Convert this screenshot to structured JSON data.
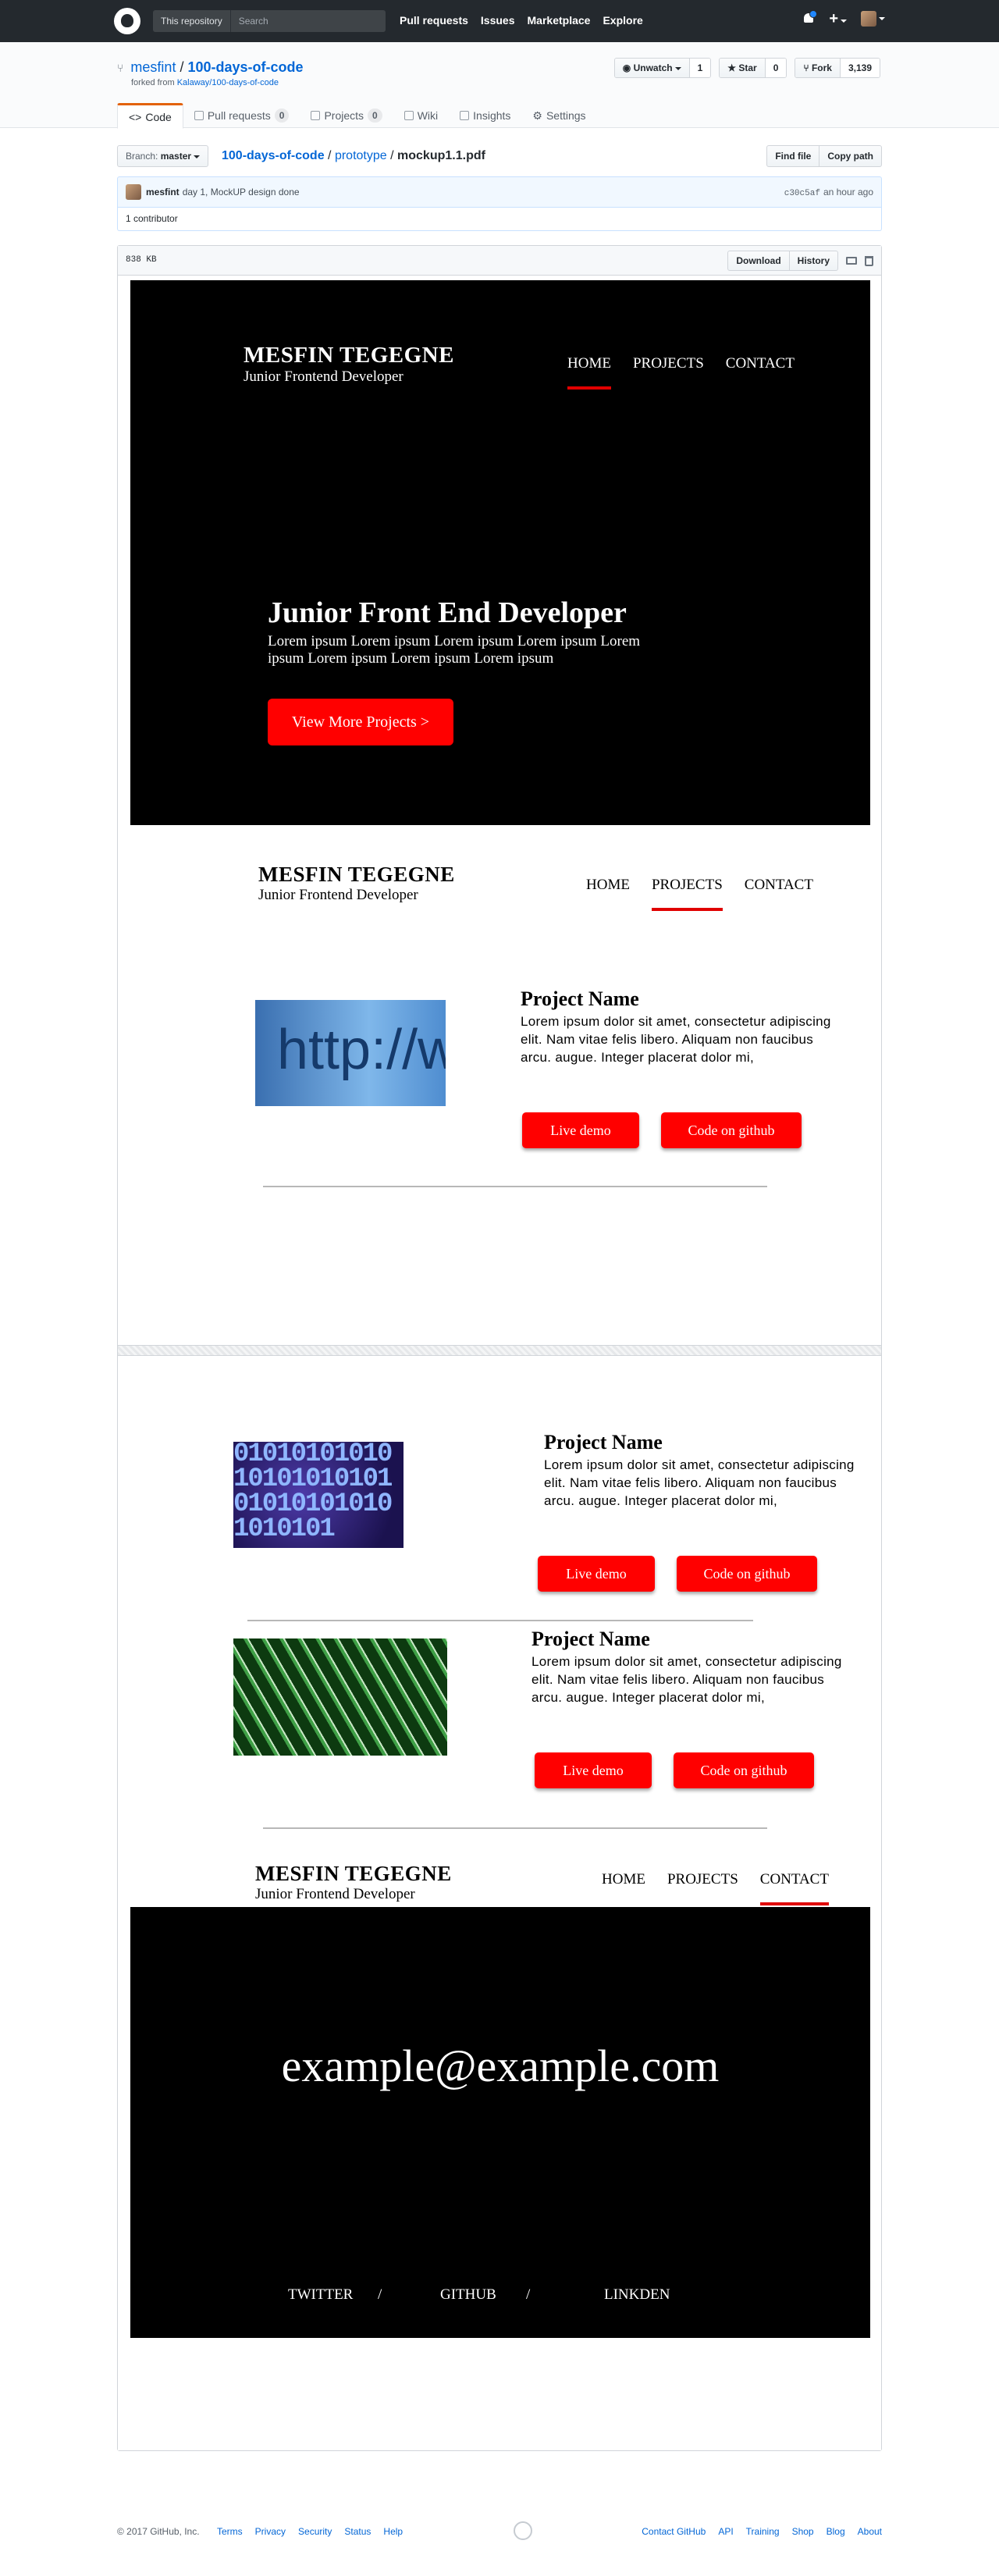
{
  "header": {
    "search_scope": "This repository",
    "search_placeholder": "Search",
    "nav": [
      "Pull requests",
      "Issues",
      "Marketplace",
      "Explore"
    ]
  },
  "repo": {
    "owner": "mesfint",
    "separator": "/",
    "name": "100-days-of-code",
    "forked_prefix": "forked from",
    "forked_from": "Kalaway/100-days-of-code",
    "watch_label": "Unwatch",
    "watch_count": "1",
    "star_label": "Star",
    "star_count": "0",
    "fork_label": "Fork",
    "fork_count": "3,139",
    "tabs": [
      {
        "label": "Code"
      },
      {
        "label": "Pull requests",
        "count": "0"
      },
      {
        "label": "Projects",
        "count": "0"
      },
      {
        "label": "Wiki"
      },
      {
        "label": "Insights"
      },
      {
        "label": "Settings"
      }
    ]
  },
  "file_nav": {
    "branch_prefix": "Branch:",
    "branch": "master",
    "crumb_repo": "100-days-of-code",
    "crumb_dir": "prototype",
    "crumb_file": "mockup1.1.pdf",
    "find_file": "Find file",
    "copy_path": "Copy path"
  },
  "commit": {
    "author": "mesfint",
    "message": "day 1, MockUP design done",
    "sha": "c30c5af",
    "time": "an hour ago",
    "contributors": "1 contributor"
  },
  "file": {
    "size": "838 KB",
    "download": "Download",
    "history": "History"
  },
  "mockup": {
    "brand_name": "MESFIN TEGEGNE",
    "brand_role": "Junior Frontend Developer",
    "nav": [
      "HOME",
      "PROJECTS",
      "CONTACT"
    ],
    "hero_title": "Junior Front End Developer",
    "hero_text": "Lorem ipsum Lorem ipsum Lorem ipsum Lorem ipsum Lorem ipsum Lorem ipsum Lorem ipsum Lorem ipsum",
    "hero_button": "View More Projects  >",
    "project_title": "Project Name",
    "project_desc": "Lorem ipsum dolor sit amet, consectetur adipiscing elit. Nam vitae felis libero. Aliquam non faucibus arcu. augue. Integer placerat dolor mi,",
    "live_demo": "Live demo",
    "code_github": "Code on github",
    "img1_text": "http://www",
    "img2_text": "0101010101010101010101010101010101010101",
    "email": "example@example.com",
    "social": [
      "TWITTER",
      "/",
      "GITHUB",
      "/",
      "LINKDEN"
    ]
  },
  "footer": {
    "copyright": "© 2017 GitHub, Inc.",
    "left_links": [
      "Terms",
      "Privacy",
      "Security",
      "Status",
      "Help"
    ],
    "right_links": [
      "Contact GitHub",
      "API",
      "Training",
      "Shop",
      "Blog",
      "About"
    ]
  },
  "colors": {
    "header_bg": "#24292e",
    "link": "#0366d6",
    "accent_red": "#ff0000",
    "tab_active": "#e36209"
  }
}
